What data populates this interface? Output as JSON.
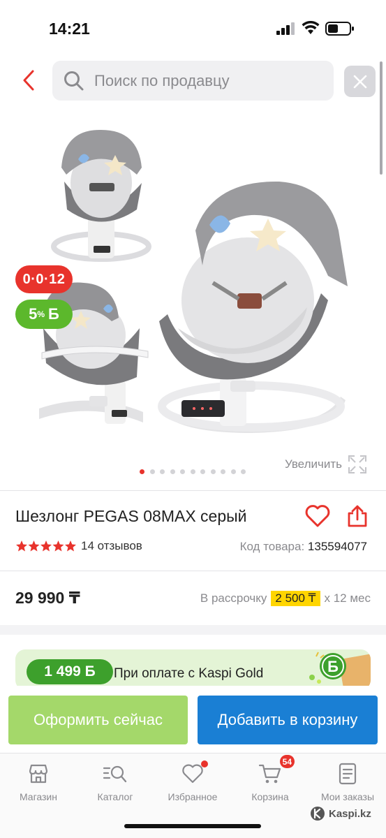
{
  "status_bar": {
    "time": "14:21"
  },
  "search": {
    "placeholder": "Поиск по продавцу"
  },
  "gallery": {
    "installment_badge": "0·0·12",
    "bonus_percent": "5",
    "bonus_suffix": "%",
    "bonus_currency": "Б",
    "zoom_label": "Увеличить",
    "image_count": 11,
    "active_index": 0
  },
  "product": {
    "title": "Шезлонг PEGAS 08MAX серый",
    "rating_stars": 5,
    "reviews": "14 отзывов",
    "code_label": "Код товара:",
    "code_value": "135594077",
    "price": "29 990 ₸",
    "installment_label": "В рассрочку",
    "installment_amount": "2 500 ₸",
    "installment_term": "х 12 мес"
  },
  "promo": {
    "bonus": "1 499 Б",
    "text": "При оплате с Kaspi Gold"
  },
  "actions": {
    "buy_now": "Оформить сейчас",
    "add_to_cart": "Добавить в корзину"
  },
  "tabbar": {
    "items": [
      {
        "label": "Магазин",
        "icon": "shop-icon"
      },
      {
        "label": "Каталог",
        "icon": "catalog-search-icon"
      },
      {
        "label": "Избранное",
        "icon": "heart-icon"
      },
      {
        "label": "Корзина",
        "icon": "cart-icon",
        "badge": "54"
      },
      {
        "label": "Мои заказы",
        "icon": "orders-icon"
      }
    ]
  },
  "watermark": "Kaspi.kz",
  "colors": {
    "accent_red": "#e8332c",
    "bonus_green": "#5cb82c",
    "buy_now_green": "#a4d86a",
    "cart_blue": "#1a7fd4",
    "highlight_yellow": "#ffd500"
  }
}
